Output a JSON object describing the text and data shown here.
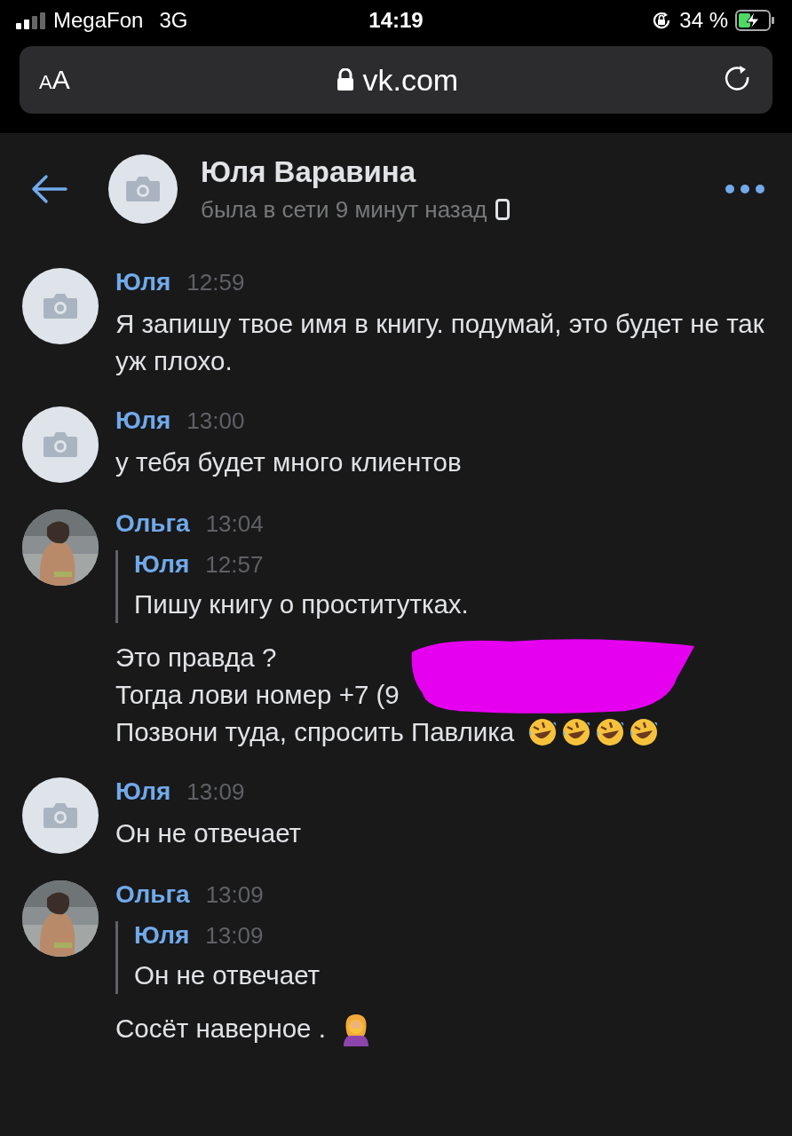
{
  "status_bar": {
    "carrier": "MegaFon",
    "network": "3G",
    "time": "14:19",
    "battery": "34 %",
    "charging": true,
    "rotation_lock": true
  },
  "address_bar": {
    "text_size_button": {
      "small": "A",
      "large": "A"
    },
    "url": "vk.com",
    "secure": true
  },
  "header": {
    "name": "Юля Варавина",
    "last_seen": "была в сети 9 минут назад",
    "mobile": true
  },
  "messages": [
    {
      "author": "Юля",
      "time": "12:59",
      "avatar": {
        "kind": "placeholder"
      },
      "lines": [
        "Я запишу твое имя в книгу. подумай, это будет не так уж плохо."
      ]
    },
    {
      "author": "Юля",
      "time": "13:00",
      "avatar": {
        "kind": "placeholder"
      },
      "lines": [
        "у тебя будет много клиентов"
      ]
    },
    {
      "author": "Ольга",
      "time": "13:04",
      "avatar": {
        "kind": "picture"
      },
      "quote": {
        "author": "Юля",
        "time": "12:57",
        "text": "Пишу книгу о проститутках."
      },
      "lines": [
        "Это правда ?",
        "Тогда лови номер +7 (9",
        "Позвони туда, спросить Павлика"
      ],
      "emoji": [
        {
          "kind": "rofl"
        },
        {
          "kind": "rofl"
        },
        {
          "kind": "rofl"
        },
        {
          "kind": "rofl"
        }
      ],
      "redacted": true
    },
    {
      "author": "Юля",
      "time": "13:09",
      "avatar": {
        "kind": "placeholder"
      },
      "lines": [
        "Он не отвечает"
      ]
    },
    {
      "author": "Ольга",
      "time": "13:09",
      "avatar": {
        "kind": "picture"
      },
      "quote": {
        "author": "Юля",
        "time": "13:09",
        "text": "Он не отвечает"
      },
      "lines": [
        "Сосёт наверное ."
      ],
      "emoji": [
        {
          "kind": "facepalm"
        }
      ]
    }
  ]
}
